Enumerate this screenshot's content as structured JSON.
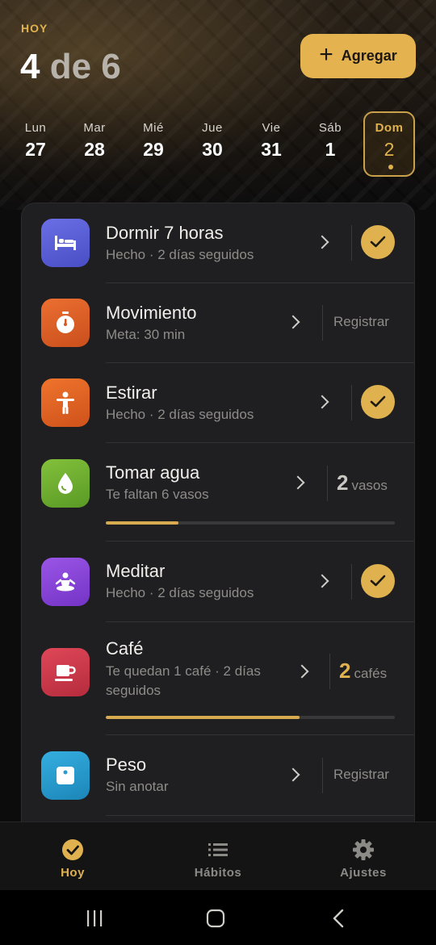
{
  "header": {
    "today_label": "HOY",
    "progress_done": "4",
    "progress_rest": " de 6",
    "add_button_label": "Agregar"
  },
  "week": [
    {
      "name": "Lun",
      "date": "27",
      "selected": false
    },
    {
      "name": "Mar",
      "date": "28",
      "selected": false
    },
    {
      "name": "Mié",
      "date": "29",
      "selected": false
    },
    {
      "name": "Jue",
      "date": "30",
      "selected": false
    },
    {
      "name": "Vie",
      "date": "31",
      "selected": false
    },
    {
      "name": "Sáb",
      "date": "1",
      "selected": false
    },
    {
      "name": "Dom",
      "date": "2",
      "selected": true
    }
  ],
  "habits": [
    {
      "name": "Dormir 7 horas",
      "subtitle": "Hecho · 2 días seguidos",
      "icon": "bed-icon",
      "icon_color": "#5b5fd6",
      "action": "check",
      "completed": true
    },
    {
      "name": "Movimiento",
      "subtitle": "Meta: 30 min",
      "icon": "stopwatch-icon",
      "icon_color": "#e0642a",
      "action": "register",
      "action_label": "Registrar"
    },
    {
      "name": "Estirar",
      "subtitle": "Hecho · 2 días seguidos",
      "icon": "stretch-person-icon",
      "icon_color": "#e66a25",
      "action": "check",
      "completed": true
    },
    {
      "name": "Tomar agua",
      "subtitle": "Te faltan 6 vasos",
      "icon": "water-drop-icon",
      "icon_color": "#6fae2f",
      "action": "count",
      "count": "2",
      "unit": "vasos",
      "progress": 0.25
    },
    {
      "name": "Meditar",
      "subtitle": "Hecho · 2 días seguidos",
      "icon": "meditation-icon",
      "icon_color": "#8a45d8",
      "action": "check",
      "completed": true
    },
    {
      "name": "Café",
      "subtitle_line1": "Te quedan 1 café · 2 días",
      "subtitle_line2": "seguidos",
      "icon": "coffee-cup-icon",
      "icon_color": "#d03a4c",
      "action": "count",
      "count": "2",
      "unit": "cafés",
      "progress": 0.67
    },
    {
      "name": "Peso",
      "subtitle": "Sin anotar",
      "icon": "scale-icon",
      "icon_color": "#2a9bd0",
      "action": "register",
      "action_label": "Registrar"
    }
  ],
  "tabs": [
    {
      "label": "Hoy",
      "icon": "check-circle-icon",
      "active": true
    },
    {
      "label": "Hábitos",
      "icon": "list-icon",
      "active": false
    },
    {
      "label": "Ajustes",
      "icon": "gear-icon",
      "active": false
    }
  ],
  "system_nav": [
    "recent-apps-icon",
    "home-icon",
    "back-icon"
  ],
  "colors": {
    "accent": "#e0b24f",
    "card": "#1f1f21",
    "background": "#0c0c0d"
  }
}
